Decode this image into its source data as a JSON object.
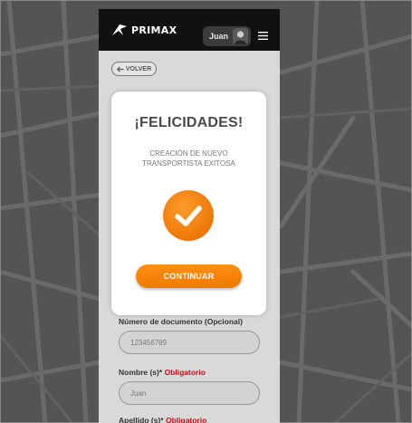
{
  "header": {
    "brand": "PRIMAX",
    "user_name": "Juan"
  },
  "nav": {
    "back_label": "VOLVER"
  },
  "modal": {
    "title": "¡FELICIDADES!",
    "message": "CREACIÓN DE NUEVO TRANSPORTISTA EXITOSA",
    "button_label": "CONTINUAR"
  },
  "form": {
    "document_label": "Número de documento (Opcional)",
    "document_value": "123456789",
    "name_label": "Nombre (s)*",
    "name_required": "Obligatorio",
    "name_value": "Juan",
    "surname_label": "Apellido (s)*",
    "surname_required": "Obligatorio"
  },
  "colors": {
    "accent": "#f07d0c",
    "topbar": "#111111",
    "required": "#c0101a"
  }
}
